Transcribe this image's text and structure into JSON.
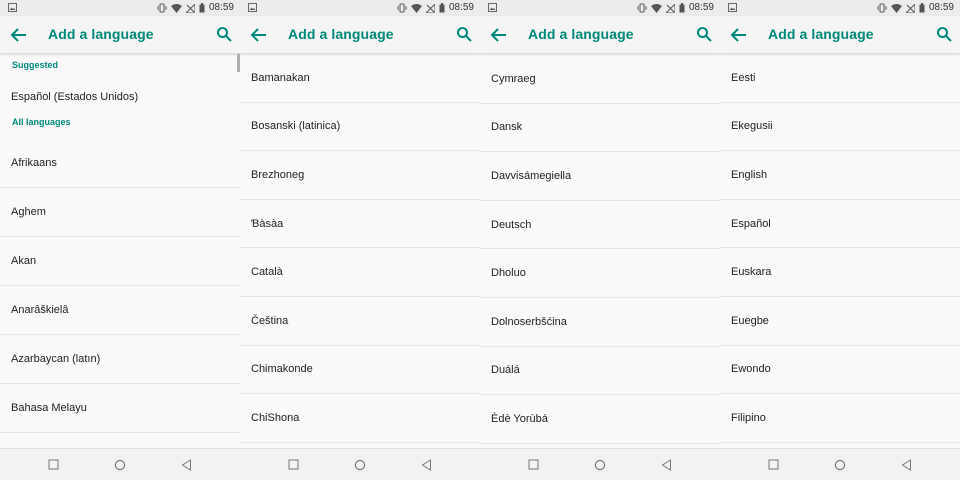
{
  "status": {
    "time": "08:59"
  },
  "header": {
    "title": "Add a language"
  },
  "panel1": {
    "suggested_label": "Suggested",
    "suggested": [
      "Español (Estados Unidos)"
    ],
    "all_label": "All languages",
    "items": [
      "Afrikaans",
      "Aghem",
      "Akan",
      "Anarâškielâ",
      "Azarbaycan (latın)",
      "Bahasa Melayu"
    ]
  },
  "panel2": {
    "items": [
      "Bamanakan",
      "Bosanski (latinica)",
      "Brezhoneg",
      "Ɓàsàa",
      "Català",
      "Čeština",
      "Chimakonde",
      "ChiShona"
    ]
  },
  "panel3": {
    "items": [
      "Cymraeg",
      "Dansk",
      "Davvisámegiella",
      "Deutsch",
      "Dholuo",
      "Dolnoserbšćina",
      "Duálá",
      "Èdè Yorùbá"
    ]
  },
  "panel4": {
    "items": [
      "Eesti",
      "Ekegusii",
      "English",
      "Español",
      "Euskara",
      "Euegbe",
      "Ewondo",
      "Filipino"
    ]
  },
  "colors": {
    "accent": "#00897b",
    "background": "#fafafa"
  },
  "icons": {
    "back": "arrow-back-icon",
    "search": "search-icon",
    "recents": "square-icon",
    "home": "circle-icon",
    "back_nav": "triangle-icon"
  }
}
